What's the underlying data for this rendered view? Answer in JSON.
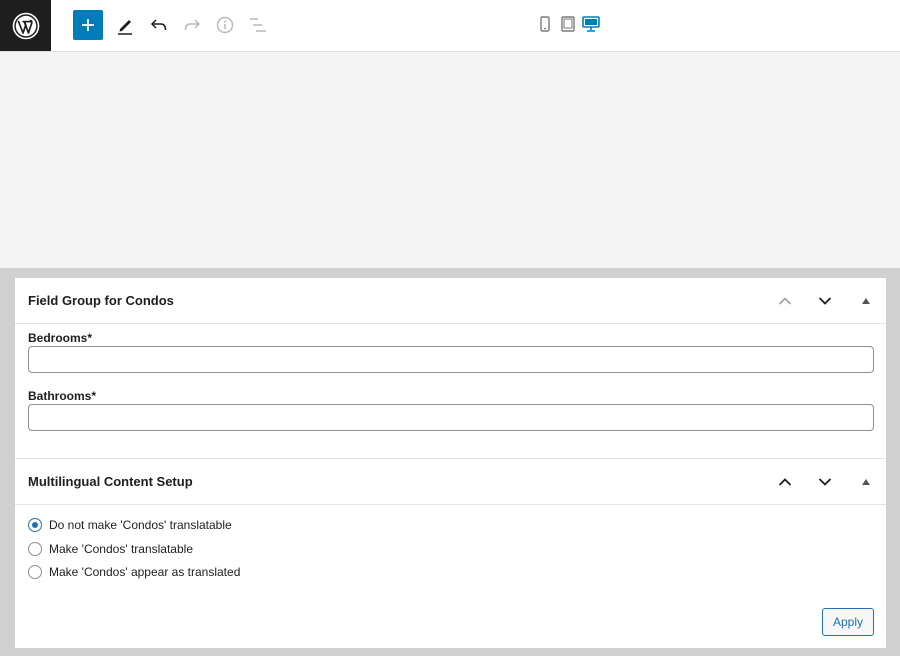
{
  "toolbar": {
    "logo_icon": "wordpress-logo-icon",
    "tools": [
      "add-block-icon",
      "edit-pencil-icon",
      "undo-icon",
      "redo-icon",
      "info-icon",
      "list-view-icon"
    ],
    "preview_devices": [
      "mobile-icon",
      "tablet-icon",
      "desktop-icon"
    ],
    "accent_color": "#007cba"
  },
  "field_group": {
    "title": "Field Group for Condos",
    "fields": [
      {
        "label": "Bedrooms*",
        "value": ""
      },
      {
        "label": "Bathrooms*",
        "value": ""
      }
    ]
  },
  "multilingual": {
    "title": "Multilingual Content Setup",
    "options": [
      {
        "label": "Do not make 'Condos' translatable",
        "checked": true
      },
      {
        "label": "Make 'Condos' translatable",
        "checked": false
      },
      {
        "label": "Make 'Condos' appear as translated",
        "checked": false
      }
    ],
    "apply_label": "Apply"
  }
}
